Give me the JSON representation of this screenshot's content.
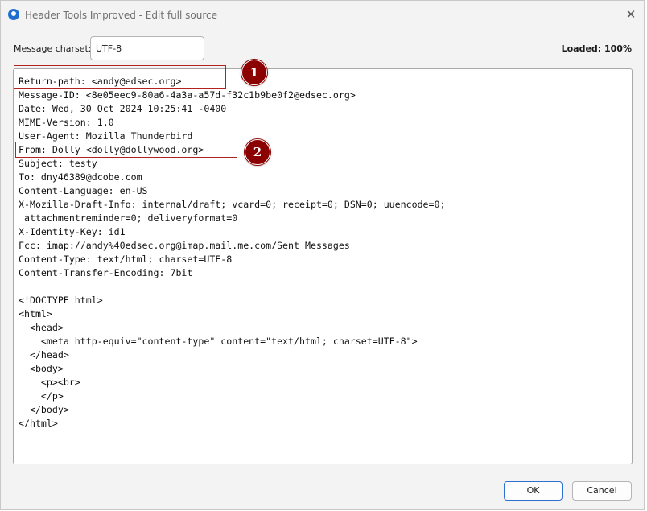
{
  "window": {
    "title": "Header Tools Improved - Edit full source",
    "app_icon": "thunderbird-icon",
    "close_icon": "close-icon"
  },
  "charset": {
    "label": "Message charset:",
    "value": "UTF-8"
  },
  "status": {
    "loaded_text": "Loaded: 100%"
  },
  "source": {
    "text": "Return-path: <andy@edsec.org>\nMessage-ID: <8e05eec9-80a6-4a3a-a57d-f32c1b9be0f2@edsec.org>\nDate: Wed, 30 Oct 2024 10:25:41 -0400\nMIME-Version: 1.0\nUser-Agent: Mozilla Thunderbird\nFrom: Dolly <dolly@dollywood.org>\nSubject: testy\nTo: dny46389@dcobe.com\nContent-Language: en-US\nX-Mozilla-Draft-Info: internal/draft; vcard=0; receipt=0; DSN=0; uuencode=0;\n attachmentreminder=0; deliveryformat=0\nX-Identity-Key: id1\nFcc: imap://andy%40edsec.org@imap.mail.me.com/Sent Messages\nContent-Type: text/html; charset=UTF-8\nContent-Transfer-Encoding: 7bit\n\n<!DOCTYPE html>\n<html>\n  <head>\n    <meta http-equiv=\"content-type\" content=\"text/html; charset=UTF-8\">\n  </head>\n  <body>\n    <p><br>\n    </p>\n  </body>\n</html>"
  },
  "annotations": [
    {
      "number": "1",
      "color": "#8b0000"
    },
    {
      "number": "2",
      "color": "#8b0000"
    }
  ],
  "buttons": {
    "ok_label": "OK",
    "cancel_label": "Cancel"
  },
  "colors": {
    "accent": "#2f6fd1",
    "highlight": "#b22222"
  }
}
